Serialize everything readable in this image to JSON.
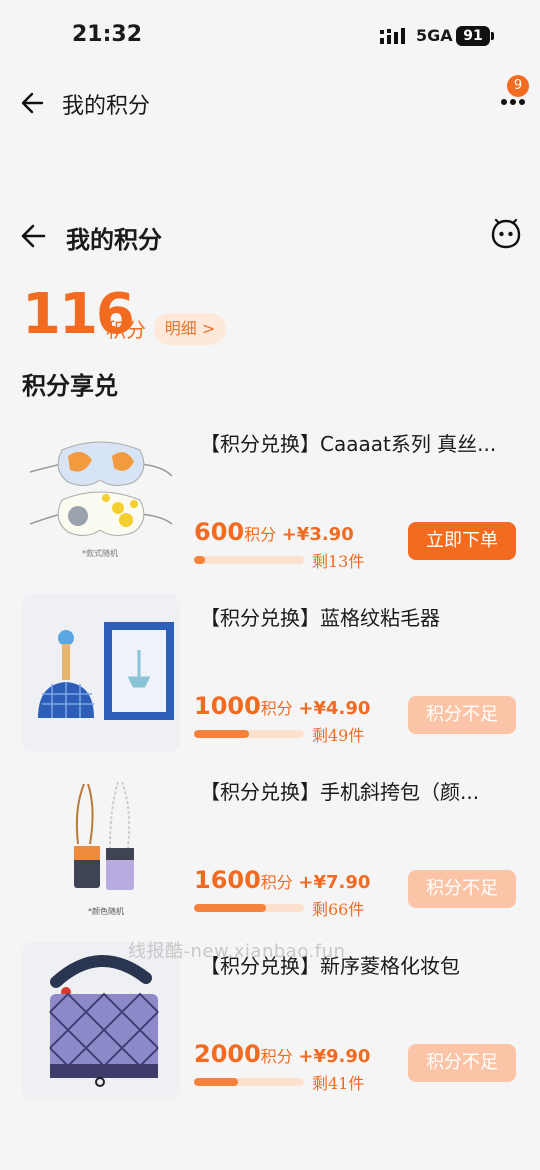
{
  "status": {
    "time": "21:32",
    "network": "5GA",
    "battery": "91"
  },
  "topbar": {
    "title": "我的积分",
    "notification_count": "9"
  },
  "header": {
    "title": "我的积分"
  },
  "points": {
    "value": "116",
    "unit": "积分",
    "detail_label": "明细 >"
  },
  "section_title": "积分享兑",
  "items": [
    {
      "name": "【积分兑换】Caaaat系列 真丝...",
      "points": "600",
      "points_unit": "积分",
      "plus": "+",
      "cash": "¥3.90",
      "stock": "剩13件",
      "progress": 0.1,
      "button": "立即下单",
      "button_state": "active",
      "thumb_caption": "*款式随机"
    },
    {
      "name": "【积分兑换】蓝格纹粘毛器",
      "points": "1000",
      "points_unit": "积分",
      "plus": "+",
      "cash": "¥4.90",
      "stock": "剩49件",
      "progress": 0.5,
      "button": "积分不足",
      "button_state": "disabled",
      "thumb_caption": ""
    },
    {
      "name": "【积分兑换】手机斜挎包（颜...",
      "points": "1600",
      "points_unit": "积分",
      "plus": "+",
      "cash": "¥7.90",
      "stock": "剩66件",
      "progress": 0.65,
      "button": "积分不足",
      "button_state": "disabled",
      "thumb_caption": "*颜色随机"
    },
    {
      "name": "【积分兑换】新序菱格化妆包",
      "points": "2000",
      "points_unit": "积分",
      "plus": "+",
      "cash": "¥9.90",
      "stock": "剩41件",
      "progress": 0.4,
      "button": "积分不足",
      "button_state": "disabled",
      "thumb_caption": ""
    }
  ],
  "watermark": "线报酷-new.xianbao.fun",
  "colors": {
    "accent": "#f26b21",
    "accent_light": "#fbc4a6"
  }
}
